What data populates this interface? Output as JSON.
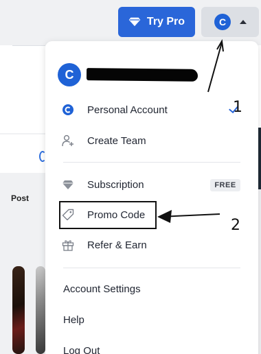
{
  "header": {
    "try_pro_label": "Try Pro",
    "avatar_letter": "C",
    "try_pro_color": "#2a66d9"
  },
  "background": {
    "post_label": "Post"
  },
  "menu": {
    "avatar_letter": "C",
    "items": [
      {
        "label": "Personal Account",
        "icon": "account-c-icon"
      },
      {
        "label": "Create Team",
        "icon": "add-person-icon"
      },
      {
        "label": "Subscription",
        "icon": "diamond-icon",
        "badge": "FREE"
      },
      {
        "label": "Promo Code",
        "icon": "tag-icon"
      },
      {
        "label": "Refer & Earn",
        "icon": "gift-icon"
      }
    ],
    "links": [
      "Account Settings",
      "Help",
      "Log Out"
    ]
  },
  "annotations": {
    "label_1": "1",
    "label_2": "2"
  }
}
